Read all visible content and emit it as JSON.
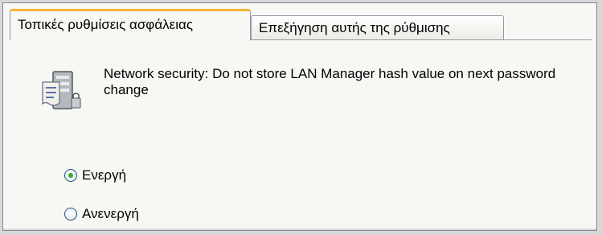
{
  "tabs": [
    {
      "label": "Τοπικές ρυθμίσεις ασφάλειας",
      "active": true
    },
    {
      "label": "Επεξήγηση αυτής της ρύθμισης",
      "active": false
    }
  ],
  "policy": {
    "icon": "security-policy-icon",
    "description": "Network security: Do not store LAN Manager hash value on next password change"
  },
  "options": [
    {
      "label": "Ενεργή",
      "selected": true
    },
    {
      "label": "Ανενεργή",
      "selected": false
    }
  ],
  "colors": {
    "active_tab_accent": "#f3b33a",
    "radio_selected": "#36a833",
    "border": "#8e9aa8"
  }
}
